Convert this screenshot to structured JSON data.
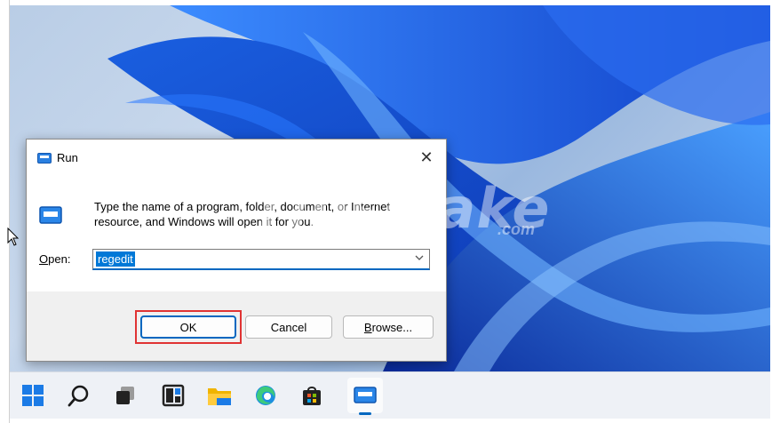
{
  "run_dialog": {
    "title": "Run",
    "close_symbol": "✕",
    "description": "Type the name of a program, folder, document, or Internet resource, and Windows will open it for you.",
    "open_label_underlined": "O",
    "open_label_rest": "pen:",
    "open_value": "regedit",
    "buttons": {
      "ok": "OK",
      "cancel": "Cancel",
      "browse_underlined": "B",
      "browse_rest": "rowse..."
    }
  },
  "watermark": {
    "text": "TipsMake",
    "suffix": ".com"
  },
  "taskbar": {
    "icons": [
      {
        "name": "start-icon"
      },
      {
        "name": "search-icon"
      },
      {
        "name": "task-view-icon"
      },
      {
        "name": "widgets-icon"
      },
      {
        "name": "file-explorer-icon"
      },
      {
        "name": "edge-icon"
      },
      {
        "name": "store-icon"
      },
      {
        "name": "run-icon"
      }
    ]
  },
  "colors": {
    "accent": "#0067c0",
    "highlight": "#e03333",
    "selection": "#0078d7"
  }
}
